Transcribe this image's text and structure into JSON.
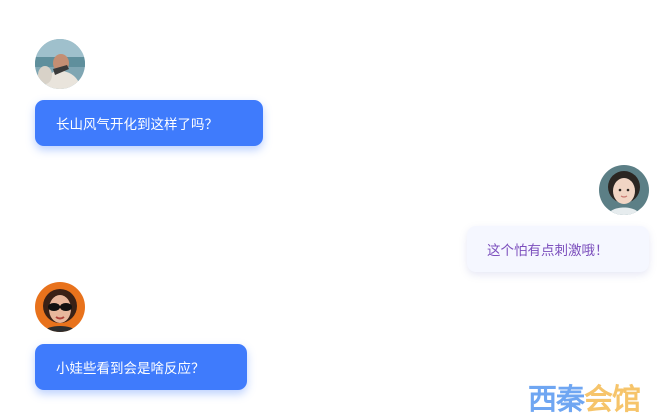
{
  "messages": [
    {
      "side": "left",
      "text": "长山风气开化到这样了吗？",
      "avatar": "avatar-woman-beach"
    },
    {
      "side": "right",
      "text": "这个怕有点刺激哦！",
      "avatar": "avatar-girl-portrait"
    },
    {
      "side": "left",
      "text": "小娃些看到会是啥反应？",
      "avatar": "avatar-woman-sunglasses"
    }
  ],
  "watermark": {
    "part1": "西秦",
    "part2": "会馆"
  },
  "colors": {
    "left_bubble": "#3f7bfc",
    "right_bubble_bg": "#f5f7ff",
    "right_bubble_text": "#7c4fbd"
  }
}
